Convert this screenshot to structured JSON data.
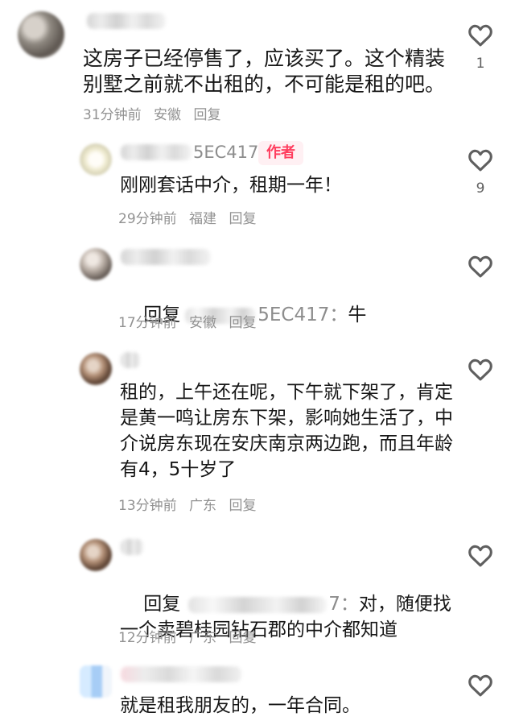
{
  "comments": [
    {
      "content": "这房子已经停售了，应该买了。这个精装别墅之前就不出租的，不可能是租的吧。",
      "time": "31分钟前",
      "region": "安徽",
      "reply": "回复",
      "likes": "1"
    },
    {
      "username_tail": "5EC417",
      "badge": "作者",
      "content": "刚刚套话中介，租期一年！",
      "time": "29分钟前",
      "region": "福建",
      "reply": "回复",
      "likes": "9"
    },
    {
      "prefix": "回复",
      "mention_tail": "5EC417：",
      "content": "牛",
      "time": "17分钟前",
      "region": "安徽",
      "reply": "回复",
      "likes": ""
    },
    {
      "content": "租的，上午还在呢，下午就下架了，肯定是黄一鸣让房东下架，影响她生活了，中介说房东现在安庆南京两边跑，而且年龄有4，5十岁了",
      "time": "13分钟前",
      "region": "广东",
      "reply": "回复",
      "likes": ""
    },
    {
      "prefix": "回复",
      "mention_tail": "7：",
      "content": "对，随便找一个卖碧桂园钻石郡的中介都知道",
      "time": "12分钟前",
      "region": "广东",
      "reply": "回复",
      "likes": ""
    },
    {
      "content": "就是租我朋友的，一年合同。",
      "likes": ""
    }
  ]
}
